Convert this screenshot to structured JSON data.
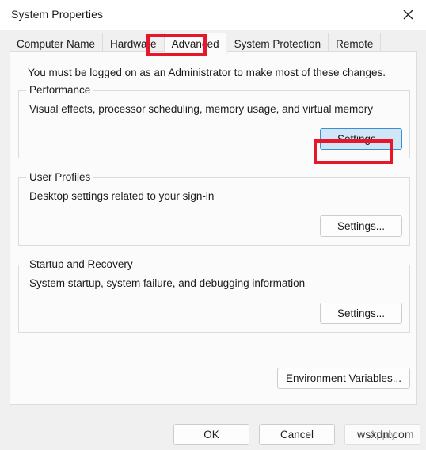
{
  "window": {
    "title": "System Properties",
    "close_icon": "close-icon"
  },
  "tabs": [
    {
      "label": "Computer Name",
      "selected": false
    },
    {
      "label": "Hardware",
      "selected": false
    },
    {
      "label": "Advanced",
      "selected": true
    },
    {
      "label": "System Protection",
      "selected": false
    },
    {
      "label": "Remote",
      "selected": false
    }
  ],
  "content": {
    "admin_note": "You must be logged on as an Administrator to make most of these changes.",
    "groups": [
      {
        "title": "Performance",
        "description": "Visual effects, processor scheduling, memory usage, and virtual memory",
        "button_label": "Settings..."
      },
      {
        "title": "User Profiles",
        "description": "Desktop settings related to your sign-in",
        "button_label": "Settings..."
      },
      {
        "title": "Startup and Recovery",
        "description": "System startup, system failure, and debugging information",
        "button_label": "Settings..."
      }
    ],
    "environment_variables_label": "Environment Variables..."
  },
  "footer": {
    "ok_label": "OK",
    "cancel_label": "Cancel",
    "apply_label": "Apply"
  },
  "annotations": {
    "color": "#e8162a",
    "targets": [
      "Advanced",
      "Settings..."
    ]
  },
  "watermark": {
    "text": "wsxdn.com"
  },
  "colors": {
    "dialog_background": "#f0f0f0",
    "panel_background": "#fbfbfb",
    "titlebar_background": "#ffffff",
    "border": "#dcdcdc",
    "text": "#1b1b1b",
    "focus_fill": "#cfe6f8",
    "focus_border": "#3b8ed0",
    "disabled_text": "#a6a6a6",
    "annotation_red": "#e8162a"
  }
}
